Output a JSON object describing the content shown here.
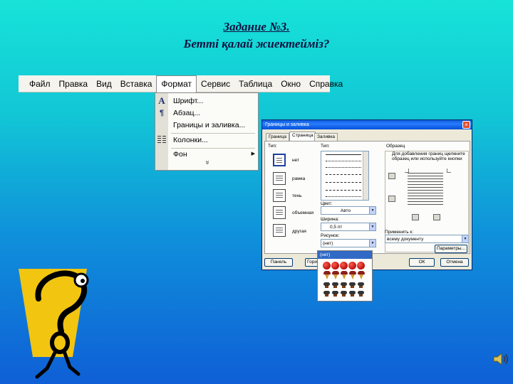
{
  "slide": {
    "title": "Задание №3.",
    "subtitle": "Бетті қалай жиектейміз?"
  },
  "menubar": {
    "items": [
      "Файл",
      "Правка",
      "Вид",
      "Вставка",
      "Формат",
      "Сервис",
      "Таблица",
      "Окно",
      "Справка"
    ],
    "open_item": "Формат"
  },
  "format_menu": {
    "items": [
      {
        "label": "Шрифт...",
        "icon": "font-A-icon"
      },
      {
        "label": "Абзац...",
        "icon": "paragraph-icon"
      },
      {
        "label": "Границы и заливка...",
        "icon": ""
      },
      {
        "label": "Колонки...",
        "icon": "columns-icon"
      },
      {
        "label": "Фон",
        "icon": "",
        "submenu": true
      }
    ],
    "more": "»"
  },
  "dialog": {
    "title": "Границы и заливка",
    "close": "×",
    "tabs": [
      "Граница",
      "Страница",
      "Заливка"
    ],
    "active_tab": "Страница",
    "type_label": "Тип:",
    "settings": [
      "нет",
      "рамка",
      "тень",
      "объемная",
      "другая"
    ],
    "style_label": "Тип:",
    "color_label": "Цвет:",
    "color_value": "Авто",
    "width_label": "Ширина:",
    "width_value": "0,5 пт",
    "art_label": "Рисунок:",
    "art_value": "(нет)",
    "preview_label": "Образец",
    "preview_hint_1": "Для добавления границ щелкните",
    "preview_hint_2": "образец или используйте кнопки",
    "apply_label": "Применить к:",
    "apply_value": "всему документу",
    "options_button": "Параметры...",
    "panel_button": "Панель",
    "hl_button": "Гори",
    "ok_button": "ОК",
    "cancel_button": "Отмена"
  },
  "art_list": {
    "selected": "(нет)"
  },
  "colors": {
    "background_top": "#17e3d8",
    "background_bottom": "#0f5fd6",
    "title": "#101040",
    "figure_yellow": "#f2c511"
  }
}
